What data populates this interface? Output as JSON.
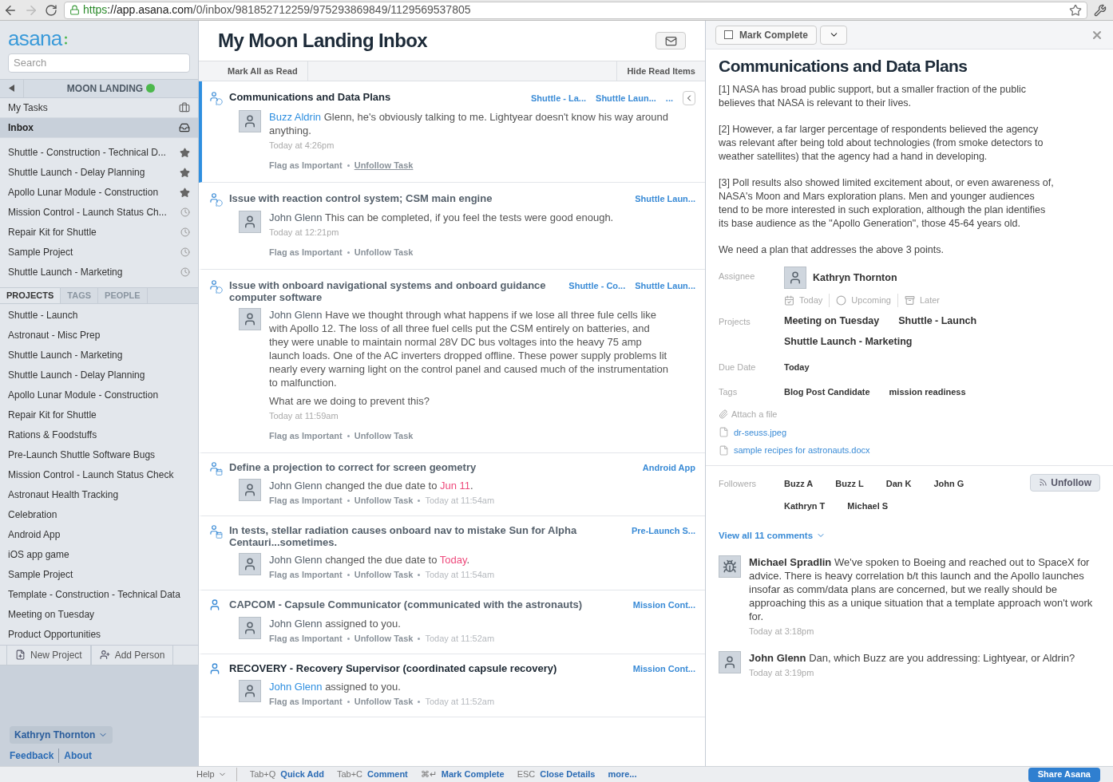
{
  "browser": {
    "url_scheme": "https",
    "url_host": "://app.asana.com",
    "url_path": "/0/inbox/981852712259/975293869849/1129569537805",
    "forward_disabled": true
  },
  "sidebar": {
    "logo": "asana",
    "search": {
      "placeholder": "Search"
    },
    "workspace": "MOON LANDING",
    "nav": [
      {
        "label": "My Tasks",
        "kind": "tasks",
        "selected": false
      },
      {
        "label": "Inbox",
        "kind": "inbox",
        "selected": true
      }
    ],
    "shortcuts": [
      {
        "label": "Shuttle - Construction - Technical D...",
        "kind": "star"
      },
      {
        "label": "Shuttle Launch - Delay Planning",
        "kind": "star"
      },
      {
        "label": "Apollo Lunar Module - Construction",
        "kind": "star"
      },
      {
        "label": "Mission Control - Launch Status Ch...",
        "kind": "recent"
      },
      {
        "label": "Repair Kit for Shuttle",
        "kind": "recent"
      },
      {
        "label": "Sample Project",
        "kind": "recent"
      },
      {
        "label": "Shuttle Launch - Marketing",
        "kind": "recent"
      }
    ],
    "tabs": [
      {
        "label": "PROJECTS",
        "selected": true
      },
      {
        "label": "TAGS",
        "selected": false
      },
      {
        "label": "PEOPLE",
        "selected": false
      }
    ],
    "projects": [
      "Shuttle - Launch",
      "Astronaut - Misc Prep",
      "Shuttle Launch - Marketing",
      "Shuttle Launch - Delay Planning",
      "Apollo Lunar Module - Construction",
      "Repair Kit for Shuttle",
      "Rations & Foodstuffs",
      "Pre-Launch Shuttle Software Bugs",
      "Mission Control - Launch Status Check",
      "Astronaut Health Tracking",
      "Celebration",
      "Android App",
      "iOS app game",
      "Sample Project",
      "Template - Construction - Technical Data",
      "Meeting on Tuesday",
      "Product Opportunities"
    ],
    "buttons": [
      "New Project",
      "Add Person"
    ],
    "user": "Kathryn Thornton",
    "links": [
      "Feedback",
      "About"
    ]
  },
  "inbox": {
    "title": "My Moon Landing Inbox",
    "toolbar": [
      "Mark All as Read",
      "Hide Read Items"
    ],
    "items": [
      {
        "kind": "comment",
        "selected": true,
        "unread": true,
        "title": "Communications and Data Plans",
        "tags": [
          "Shuttle - La...",
          "Shuttle Laun..."
        ],
        "more": "...",
        "actor": "Buzz Aldrin",
        "paragraphs": [
          "Glenn, he's obviously talking to me. Lightyear doesn't know his way around anything."
        ],
        "time": "Today at 4:26pm",
        "actions": [
          "Flag as Important",
          "Unfollow Task"
        ]
      },
      {
        "kind": "comment",
        "selected": false,
        "unread": false,
        "title": "Issue with reaction control system; CSM main engine",
        "tags": [
          "Shuttle Laun..."
        ],
        "actor": "John Glenn",
        "paragraphs": [
          "This can be completed, if you feel the tests were good enough."
        ],
        "time": "Today at 12:21pm",
        "actions": [
          "Flag as Important",
          "Unfollow Task"
        ]
      },
      {
        "kind": "comment",
        "selected": false,
        "unread": false,
        "title": "Issue with onboard navigational systems and onboard guidance computer software",
        "tags": [
          "Shuttle - Co...",
          "Shuttle Laun..."
        ],
        "actor": "John Glenn",
        "paragraphs": [
          "Have we thought through what happens if we lose all three fule cells like with Apollo 12. The loss of all three fuel cells put the CSM entirely on batteries, and they were unable to maintain normal 28V DC bus voltages into the heavy 75 amp launch loads. One of the AC inverters dropped offline. These power supply problems lit nearly every warning light on the control panel and caused much of the instrumentation to malfunction.",
          "What are we doing to prevent this?"
        ],
        "time": "Today at 11:59am",
        "actions": [
          "Flag as Important",
          "Unfollow Task"
        ]
      },
      {
        "kind": "due",
        "selected": false,
        "unread": false,
        "title": "Define a projection to correct for screen geometry",
        "tags": [
          "Android App"
        ],
        "actor": "John Glenn",
        "paragraphs": [
          "changed the due date to"
        ],
        "highlight": "Jun 11",
        "end": ".",
        "time": "Today at 11:54am",
        "actions": [
          "Flag as Important",
          "Unfollow Task"
        ]
      },
      {
        "kind": "due",
        "selected": false,
        "unread": false,
        "title": "In tests, stellar radiation causes onboard nav to mistake Sun for Alpha Centauri...sometimes.",
        "tags": [
          "Pre-Launch S..."
        ],
        "actor": "John Glenn",
        "paragraphs": [
          "changed the due date to"
        ],
        "highlight": "Today",
        "end": ".",
        "time": "Today at 11:54am",
        "actions": [
          "Flag as Important",
          "Unfollow Task"
        ]
      },
      {
        "kind": "assign",
        "selected": false,
        "unread": false,
        "title": "CAPCOM - Capsule Communicator (communicated with the astronauts)",
        "tags": [
          "Mission Cont..."
        ],
        "actor": "John Glenn",
        "paragraphs": [
          "assigned to you."
        ],
        "time": "Today at 11:52am",
        "actions": [
          "Flag as Important",
          "Unfollow Task"
        ]
      },
      {
        "kind": "assign",
        "selected": false,
        "unread": true,
        "title": "RECOVERY - Recovery Supervisor (coordinated capsule recovery)",
        "tags": [
          "Mission Cont..."
        ],
        "actor": "John Glenn",
        "paragraphs": [
          "assigned to you."
        ],
        "time": "Today at 11:52am",
        "actions": [
          "Flag as Important",
          "Unfollow Task"
        ]
      }
    ]
  },
  "details": {
    "complete_button": "Mark Complete",
    "completed": false,
    "title": "Communications and Data Plans",
    "description": [
      "[1] NASA has broad public support, but a smaller fraction of the public believes that NASA is relevant to their lives.",
      "[2] However, a far larger percentage of respondents believed the agency was relevant after being told about technologies (from smoke detectors to weather satellites) that the agency had a hand in developing.",
      "[3] Poll results also showed limited excitement about, or even awareness of, NASA's Moon and Mars exploration plans. Men and younger audiences tend to be more interested in such exploration, although the plan identifies its base audience as the \"Apollo Generation\", those 45-64 years old.",
      "We need a plan that addresses the above 3 points."
    ],
    "assignee_label": "Assignee",
    "assignee": "Kathryn Thornton",
    "schedule": [
      {
        "label": "Today",
        "kind": "today"
      },
      {
        "label": "Upcoming",
        "kind": "upcoming"
      },
      {
        "label": "Later",
        "kind": "later"
      }
    ],
    "projects_label": "Projects",
    "projects": [
      "Meeting on Tuesday",
      "Shuttle - Launch",
      "Shuttle Launch - Marketing"
    ],
    "due_label": "Due Date",
    "due": "Today",
    "tags_label": "Tags",
    "tags": [
      "Blog Post Candidate",
      "mission readiness"
    ],
    "attach": "Attach a file",
    "attachments": [
      "dr-seuss.jpeg",
      "sample recipes for astronauts.docx"
    ],
    "followers_label": "Followers",
    "followers": [
      "Buzz A",
      "Buzz L",
      "Dan K",
      "John G",
      "Kathryn T",
      "Michael S"
    ],
    "unfollow": "Unfollow",
    "view_all": "View all 11 comments",
    "comments": [
      {
        "author": "Michael Spradlin",
        "kind": "spider",
        "text": "We've spoken to Boeing and reached out to SpaceX for advice. There is heavy correlation b/t this launch and the Apollo launches insofar as comm/data plans are concerned, but we really should be approaching this as a unique situation that a template approach won't work for.",
        "time": "Today at 3:18pm"
      },
      {
        "author": "John Glenn",
        "kind": "person",
        "text": "Dan, which Buzz are you addressing: Lightyear, or Aldrin?",
        "time": "Today at 3:19pm"
      }
    ]
  },
  "footer": {
    "help": "Help",
    "shortcuts": [
      {
        "key": "Tab+Q",
        "label": "Quick Add"
      },
      {
        "key": "Tab+C",
        "label": "Comment"
      },
      {
        "key": "⌘↵",
        "label": "Mark Complete"
      },
      {
        "key": "ESC",
        "label": "Close Details"
      }
    ],
    "more": "more...",
    "share": "Share Asana"
  }
}
